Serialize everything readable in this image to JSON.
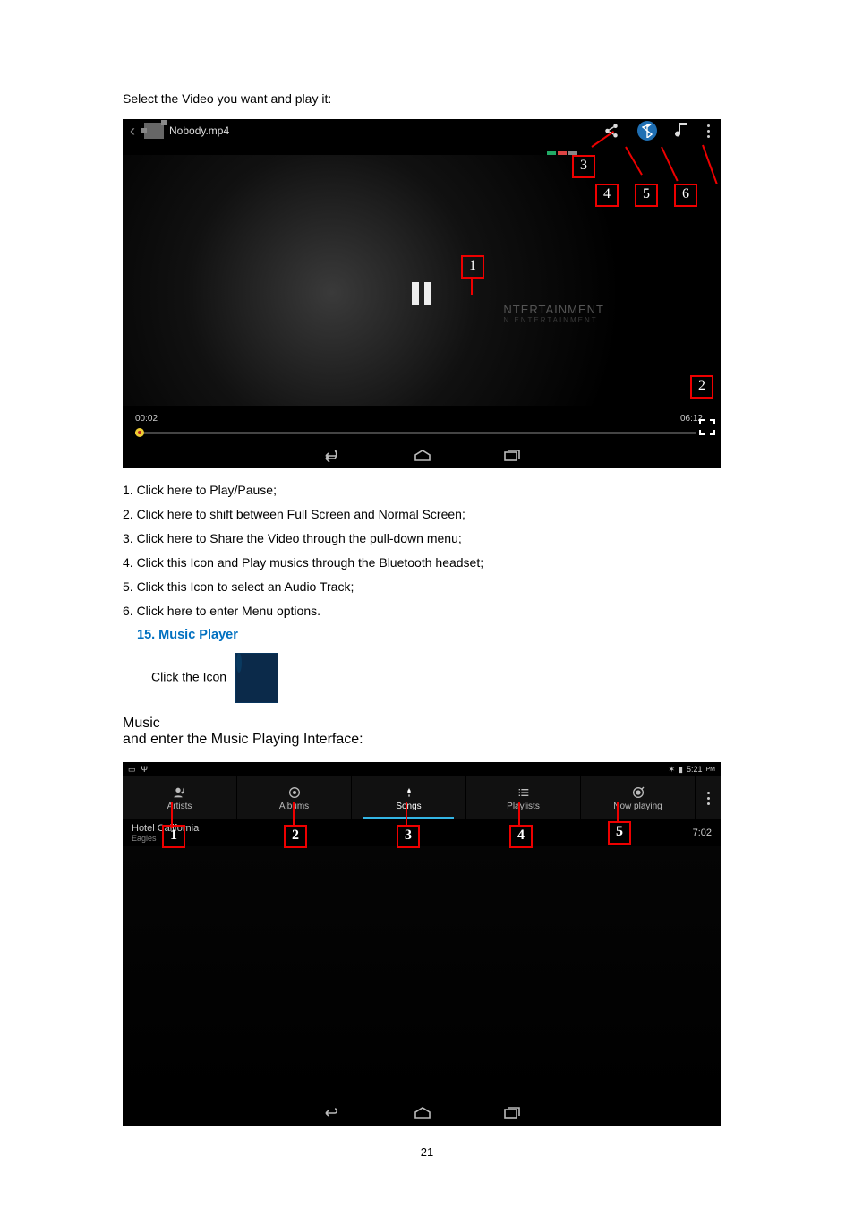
{
  "doc": {
    "lead_video": "Select the Video you want and play it:",
    "explanations": [
      "1. Click here to Play/Pause;",
      "2. Click here to shift between Full Screen and Normal Screen;",
      "3. Click here to Share the Video through the pull-down menu;",
      "4. Click this Icon and Play musics through the Bluetooth headset;",
      "5. Click this Icon to select an Audio Track;",
      "6. Click here to enter Menu options."
    ],
    "section_heading": "15.  Music Player",
    "click_icon_pre": "Click the Icon",
    "music_icon_label": "Music",
    "click_icon_post": " and enter the Music Playing Interface:",
    "page_number": "21"
  },
  "video": {
    "filename": "Nobody.mp4",
    "time_elapsed": "00:02",
    "time_total": "06:12",
    "watermark_main": "NTERTAINMENT",
    "watermark_sub": "N ENTERTAINMENT",
    "callouts": {
      "c1": "1",
      "c2": "2",
      "c3": "3",
      "c4": "4",
      "c5": "5",
      "c6": "6"
    }
  },
  "music": {
    "status_time": "5:21",
    "status_pm": "PM",
    "tabs": {
      "artists": "Artists",
      "albums": "Albums",
      "songs": "Songs",
      "playlists": "Playlists",
      "now_playing": "Now playing"
    },
    "track": {
      "title": "Hotel California",
      "artist": "Eagles",
      "duration": "7:02"
    },
    "callouts": {
      "m1": "1",
      "m2": "2",
      "m3": "3",
      "m4": "4",
      "m5": "5"
    }
  }
}
